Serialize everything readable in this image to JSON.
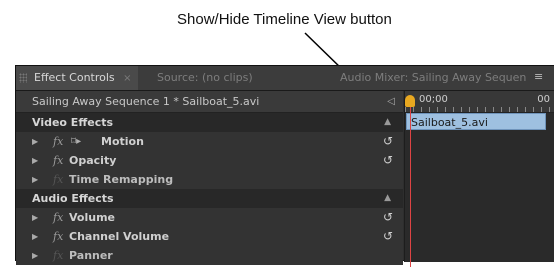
{
  "annotation": {
    "callout_text": "Show/Hide Timeline View button"
  },
  "tabs": [
    {
      "label": "Effect Controls",
      "close": "×"
    },
    {
      "label": "Source: (no clips)"
    },
    {
      "label": "Audio Mixer: Sailing Away Sequen"
    }
  ],
  "panel_menu_icon": "≡",
  "sequence_row": {
    "label": "Sailing Away Sequence 1 * Sailboat_5.avi",
    "toggle_icon": "◁"
  },
  "video_effects": {
    "header": "Video Effects",
    "items": [
      {
        "label": "Motion",
        "fx": "fx",
        "reset": "↺"
      },
      {
        "label": "Opacity",
        "fx": "fx",
        "reset": "↺"
      },
      {
        "label": "Time Remapping",
        "fx": "fx",
        "reset": ""
      }
    ]
  },
  "audio_effects": {
    "header": "Audio Effects",
    "items": [
      {
        "label": "Volume",
        "fx": "fx",
        "reset": "↺"
      },
      {
        "label": "Channel Volume",
        "fx": "fx",
        "reset": "↺"
      },
      {
        "label": "Panner",
        "fx": "fx",
        "reset": ""
      }
    ]
  },
  "timeline": {
    "timecode_start": "00;00",
    "timecode_end": "00",
    "clip_label": "Sailboat_5.avi"
  },
  "colors": {
    "panel_bg": "#2e2e2e",
    "clip": "#9ec0e0",
    "playhead": "#e8a820",
    "playhead_line": "#d44444"
  }
}
